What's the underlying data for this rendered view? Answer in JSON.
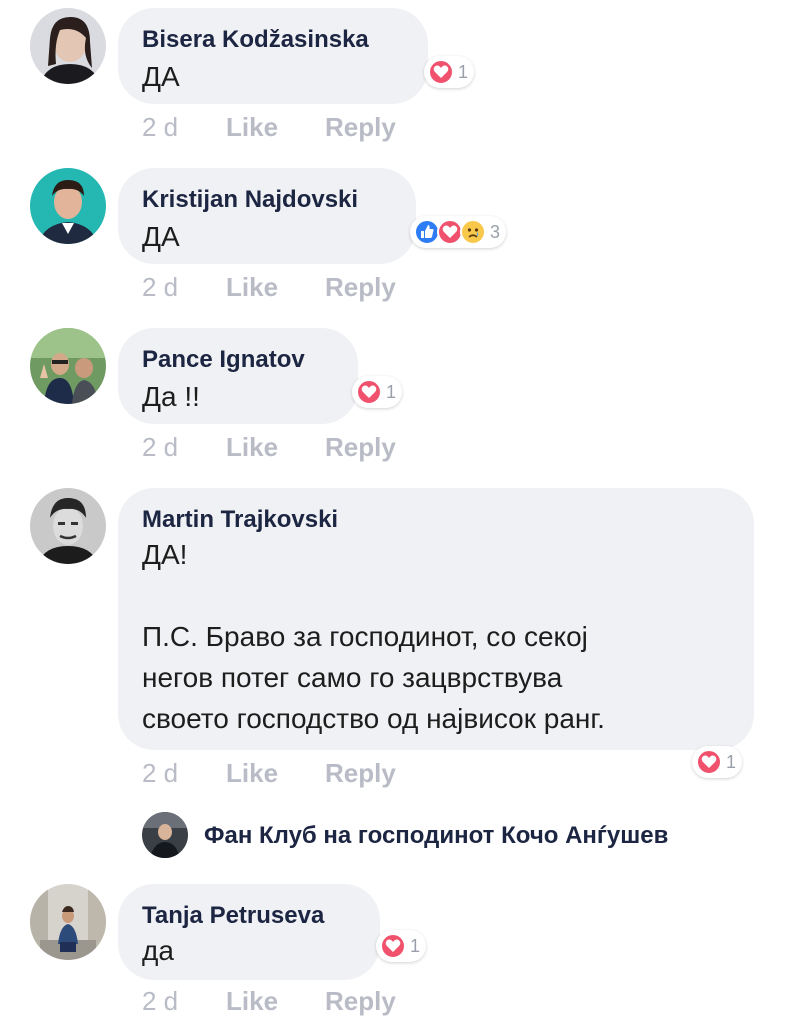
{
  "comments": [
    {
      "author": "Bisera Kodžasinska",
      "text": "ДА",
      "time": "2 d",
      "like_label": "Like",
      "reply_label": "Reply",
      "reaction_count": "1",
      "reactions": [
        "heart-icon"
      ]
    },
    {
      "author": "Kristijan Najdovski",
      "text": "ДА",
      "time": "2 d",
      "like_label": "Like",
      "reply_label": "Reply",
      "reaction_count": "3",
      "reactions": [
        "like-icon",
        "heart-icon",
        "sad-icon"
      ]
    },
    {
      "author": "Pance Ignatov",
      "text": "Да !!",
      "time": "2 d",
      "like_label": "Like",
      "reply_label": "Reply",
      "reaction_count": "1",
      "reactions": [
        "heart-icon"
      ]
    },
    {
      "author": "Martin Trajkovski",
      "text": "ДА!\n\nП.С. Браво за господинот, со секој\nнегов потег само го зацврствува\nсвоето господство од највисок ранг.",
      "time": "2 d",
      "like_label": "Like",
      "reply_label": "Reply",
      "reaction_count": "1",
      "reactions": [
        "heart-icon"
      ]
    },
    {
      "author": "Tanja Petruseva",
      "text": "да",
      "time": "2 d",
      "like_label": "Like",
      "reply_label": "Reply",
      "reaction_count": "1",
      "reactions": [
        "heart-icon"
      ]
    }
  ],
  "page_reply": {
    "author": "Фан Клуб на господинот Кочо Анѓушев"
  },
  "colors": {
    "bubble": "#f0f1f4",
    "author": "#1c2542",
    "meta": "#b9bcc6",
    "heart": "#f0526d",
    "like": "#2e7cf6",
    "sad": "#f7c84a"
  }
}
